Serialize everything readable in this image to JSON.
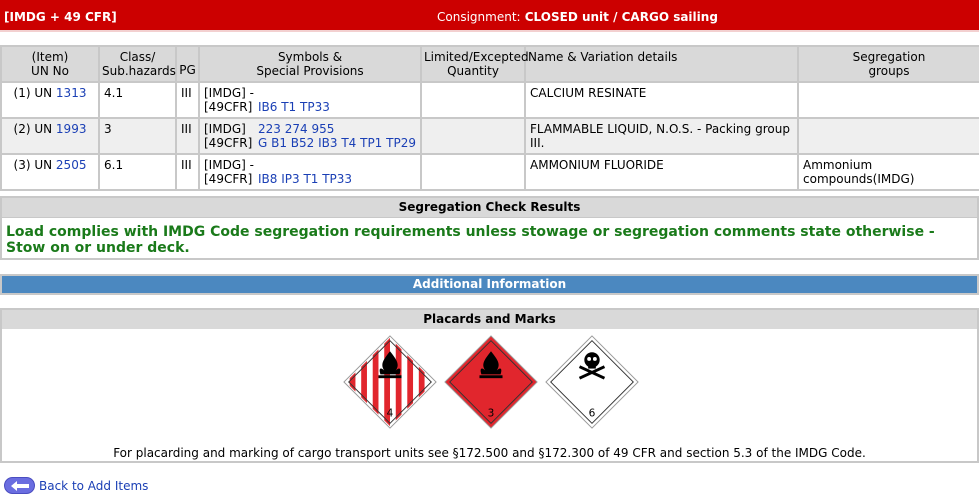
{
  "header": {
    "regs": "[IMDG + 49 CFR]",
    "consignment_label": "Consignment:",
    "consignment_value": "CLOSED unit / CARGO sailing"
  },
  "table": {
    "headers": {
      "item_line1": "(Item)",
      "item_line2": "UN No",
      "class_line1": "Class/",
      "class_line2": "Sub.hazards",
      "pg": "PG",
      "symbols_line1": "Symbols &",
      "symbols_line2": "Special Provisions",
      "limited_line1": "Limited/Excepted",
      "limited_line2": "Quantity",
      "name": "Name & Variation details",
      "seg_line1": "Segregation",
      "seg_line2": "groups"
    },
    "rows": [
      {
        "item": "(1) UN",
        "un": "1313",
        "class": "4.1",
        "pg": "III",
        "imdg_key": "[IMDG]",
        "imdg": "-",
        "cfr_key": "[49CFR]",
        "cfr": "IB6 T1 TP33",
        "limited": "",
        "name": "CALCIUM RESINATE",
        "seg": ""
      },
      {
        "item": "(2) UN",
        "un": "1993",
        "class": "3",
        "pg": "III",
        "imdg_key": "[IMDG]",
        "imdg": "223 274 955",
        "cfr_key": "[49CFR]",
        "cfr": "G B1 B52 IB3 T4 TP1 TP29",
        "limited": "",
        "name": "FLAMMABLE LIQUID, N.O.S. - Packing group III.",
        "seg": ""
      },
      {
        "item": "(3) UN",
        "un": "2505",
        "class": "6.1",
        "pg": "III",
        "imdg_key": "[IMDG]",
        "imdg": "-",
        "cfr_key": "[49CFR]",
        "cfr": "IB8 IP3 T1 TP33",
        "limited": "",
        "name": "AMMONIUM FLUORIDE",
        "seg": "Ammonium compounds(IMDG)"
      }
    ]
  },
  "segregation": {
    "title": "Segregation Check Results",
    "message": "Load complies with IMDG Code segregation requirements unless stowage or segregation comments state otherwise - Stow on or under deck."
  },
  "additional_info": "Additional Information",
  "placards": {
    "title": "Placards and Marks",
    "items": [
      {
        "class_num": "4",
        "icon": "flammable-solid-placard"
      },
      {
        "class_num": "3",
        "icon": "flammable-liquid-placard"
      },
      {
        "class_num": "6",
        "icon": "toxic-placard"
      }
    ],
    "note": "For placarding and marking of cargo transport units see §172.500 and §172.300 of 49 CFR and section 5.3 of the IMDG Code."
  },
  "back_link": "Back to Add Items",
  "colors": {
    "header_red": "#cc0000",
    "info_blue": "#4b88c0",
    "ok_green": "#1a7a1a",
    "link_blue": "#1a3fb5"
  }
}
